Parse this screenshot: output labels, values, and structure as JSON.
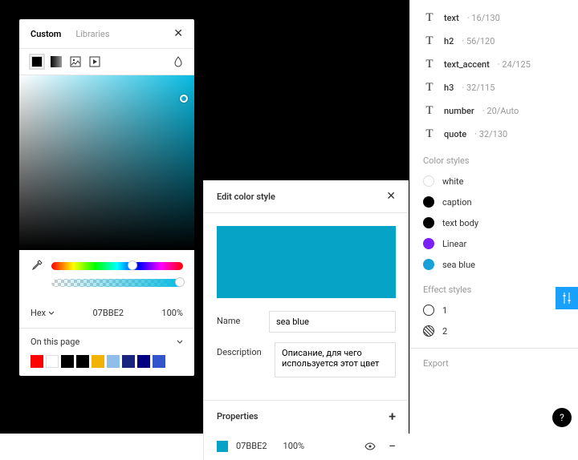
{
  "picker": {
    "tabs": {
      "custom": "Custom",
      "libraries": "Libraries"
    },
    "hexLabel": "Hex",
    "hexValue": "07BBE2",
    "opacity": "100%",
    "onThisPage": "On this page",
    "swatches": [
      "#ff0000",
      "#ffffff",
      "#000000",
      "#000000",
      "#f0b400",
      "#8fbfe8",
      "#1a237e",
      "#000080",
      "#3355cc"
    ]
  },
  "editStyle": {
    "title": "Edit color style",
    "nameLabel": "Name",
    "nameValue": "sea blue",
    "descLabel": "Description",
    "descValue": "Описание, для чего используется этот цвет",
    "propsTitle": "Properties",
    "propColor": "07BBE2",
    "propOpacity": "100%"
  },
  "textStyles": [
    {
      "name": "text",
      "vals": "16/130"
    },
    {
      "name": "h2",
      "vals": "56/120"
    },
    {
      "name": "text_accent",
      "vals": "24/125"
    },
    {
      "name": "h3",
      "vals": "32/115"
    },
    {
      "name": "number",
      "vals": "20/Auto"
    },
    {
      "name": "quote",
      "vals": "32/130"
    }
  ],
  "colorStylesTitle": "Color styles",
  "colorStyles": [
    {
      "name": "white",
      "color": "#ffffff",
      "outline": true
    },
    {
      "name": "caption",
      "color": "#000000"
    },
    {
      "name": "text body",
      "color": "#000000"
    },
    {
      "name": "Linear",
      "color": "#7b1fff"
    },
    {
      "name": "sea blue",
      "color": "#18a0d8"
    }
  ],
  "effectStylesTitle": "Effect styles",
  "effectStyles": [
    {
      "name": "1",
      "type": "shadow"
    },
    {
      "name": "2",
      "type": "blur"
    }
  ],
  "exportTitle": "Export"
}
